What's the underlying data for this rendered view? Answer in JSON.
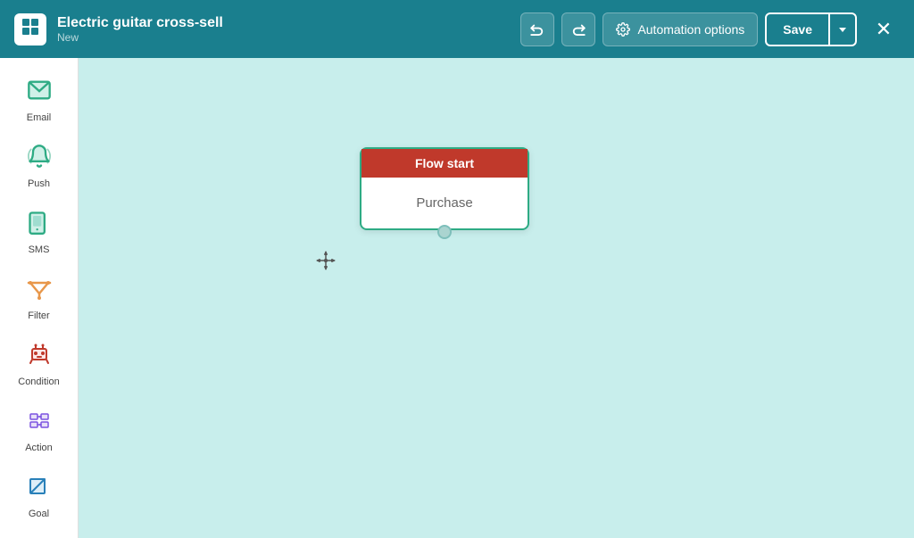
{
  "header": {
    "logo_symbol": "✦",
    "title": "Electric guitar cross-sell",
    "subtitle": "New",
    "undo_label": "↩",
    "redo_label": "↪",
    "automation_options_label": "Automation options",
    "save_label": "Save",
    "close_label": "✕"
  },
  "sidebar": {
    "items": [
      {
        "id": "email",
        "label": "Email"
      },
      {
        "id": "push",
        "label": "Push"
      },
      {
        "id": "sms",
        "label": "SMS"
      },
      {
        "id": "filter",
        "label": "Filter"
      },
      {
        "id": "condition",
        "label": "Condition"
      },
      {
        "id": "action",
        "label": "Action"
      },
      {
        "id": "goal",
        "label": "Goal"
      }
    ]
  },
  "canvas": {
    "flow_node": {
      "header": "Flow start",
      "body": "Purchase"
    }
  }
}
